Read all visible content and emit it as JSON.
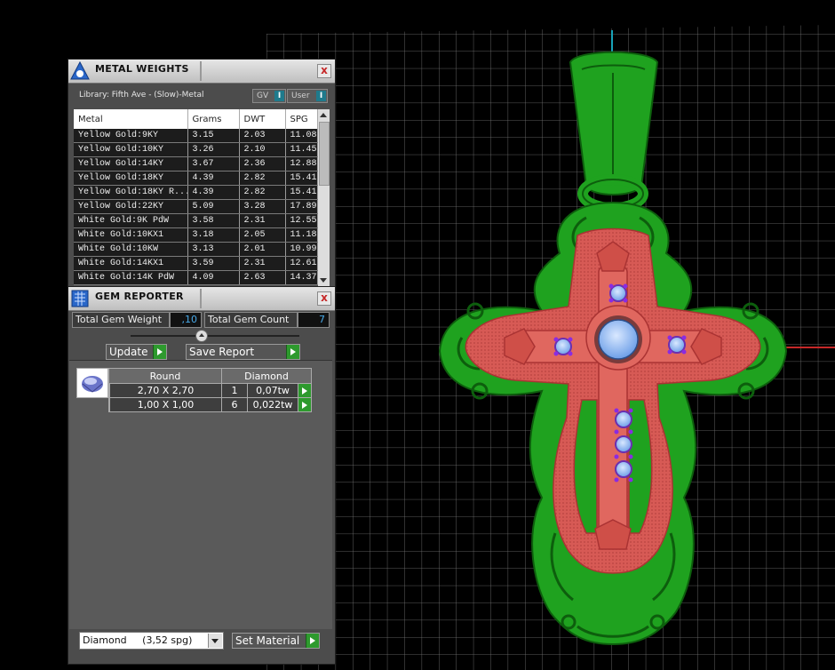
{
  "metal_weights": {
    "title": "METAL WEIGHTS",
    "close_label": "x",
    "library_label": "Library: Fifth Ave - (Slow)-Metal",
    "gv_toggle": {
      "label": "GV",
      "state": "I"
    },
    "user_toggle": {
      "label": "User",
      "state": "I"
    },
    "columns": [
      "Metal",
      "Grams",
      "DWT",
      "SPG"
    ],
    "rows": [
      [
        "Yellow Gold:9KY",
        "3.15",
        "2.03",
        "11.08"
      ],
      [
        "Yellow Gold:10KY",
        "3.26",
        "2.10",
        "11.45"
      ],
      [
        "Yellow Gold:14KY",
        "3.67",
        "2.36",
        "12.88"
      ],
      [
        "Yellow Gold:18KY",
        "4.39",
        "2.82",
        "15.41"
      ],
      [
        "Yellow Gold:18KY R...",
        "4.39",
        "2.82",
        "15.41"
      ],
      [
        "Yellow Gold:22KY",
        "5.09",
        "3.28",
        "17.89"
      ],
      [
        "White Gold:9K PdW",
        "3.58",
        "2.31",
        "12.55"
      ],
      [
        "White Gold:10KX1",
        "3.18",
        "2.05",
        "11.18"
      ],
      [
        "White Gold:10KW",
        "3.13",
        "2.01",
        "10.99"
      ],
      [
        "White Gold:14KX1",
        "3.59",
        "2.31",
        "12.61"
      ],
      [
        "White Gold:14K PdW",
        "4.09",
        "2.63",
        "14.37"
      ]
    ]
  },
  "gem_reporter": {
    "title": "GEM REPORTER",
    "close_label": "x",
    "total_gem_weight_label": "Total Gem Weight",
    "total_gem_weight_value": ",10",
    "total_gem_count_label": "Total Gem Count",
    "total_gem_count_value": "7",
    "update_label": "Update",
    "save_report_label": "Save Report",
    "table": {
      "shape_header": "Round",
      "material_header": "Diamond",
      "rows": [
        {
          "size": "2,70 X 2,70",
          "count": "1",
          "weight": "0,07tw"
        },
        {
          "size": "1,00 X 1,00",
          "count": "6",
          "weight": "0,022tw"
        }
      ]
    },
    "material_select_value": "Diamond     (3,52 spg)",
    "set_material_label": "Set Material"
  },
  "viewport": {
    "grid_color": "#7a7a7a",
    "metal_color": "#1fa21f",
    "enamel_color": "#d9534f",
    "gem_color": "#8ab4f8",
    "accent_gem_color": "#7b3fb8"
  }
}
